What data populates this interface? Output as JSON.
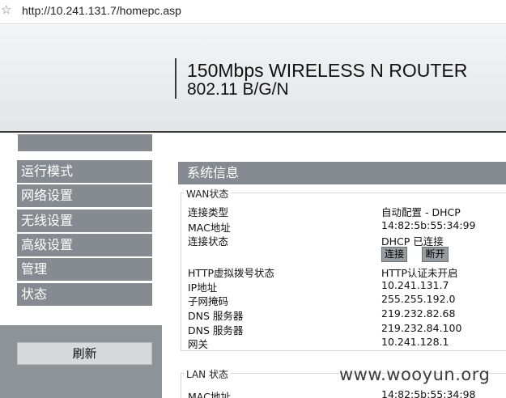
{
  "browser": {
    "url": "http://10.241.131.7/homepc.asp"
  },
  "banner": {
    "title": "150Mbps WIRELESS N ROUTER",
    "subtitle": "802.11 B/G/N"
  },
  "nav": {
    "items": [
      {
        "label": "运行模式"
      },
      {
        "label": "网络设置"
      },
      {
        "label": "无线设置"
      },
      {
        "label": "高级设置"
      },
      {
        "label": "管理"
      },
      {
        "label": "状态"
      }
    ],
    "refresh_label": "刷新"
  },
  "system_info": {
    "header": "系统信息",
    "wan": {
      "legend": "WAN状态",
      "connection_type_label": "连接类型",
      "connection_type_value": "自动配置 - DHCP",
      "mac_label": "MAC地址",
      "mac_value": "14:82:5b:55:34:99",
      "status_label": "连接状态",
      "status_value": "DHCP 已连接",
      "connect_button": "连接",
      "disconnect_button": "断开",
      "http_dial_label": "HTTP虚拟拨号状态",
      "http_dial_value": "HTTP认证未开启",
      "ip_label": "IP地址",
      "ip_value": "10.241.131.7",
      "subnet_label": "子网掩码",
      "subnet_value": "255.255.192.0",
      "dns1_label": "DNS 服务器",
      "dns1_value": "219.232.82.68",
      "dns2_label": "DNS 服务器",
      "dns2_value": "219.232.84.100",
      "gateway_label": "网关",
      "gateway_value": "10.241.128.1"
    },
    "lan": {
      "legend": "LAN 状态",
      "mac_label": "MAC地址",
      "mac_value": "14:82:5b:55:34:98"
    }
  },
  "watermark": "www.wooyun.org"
}
